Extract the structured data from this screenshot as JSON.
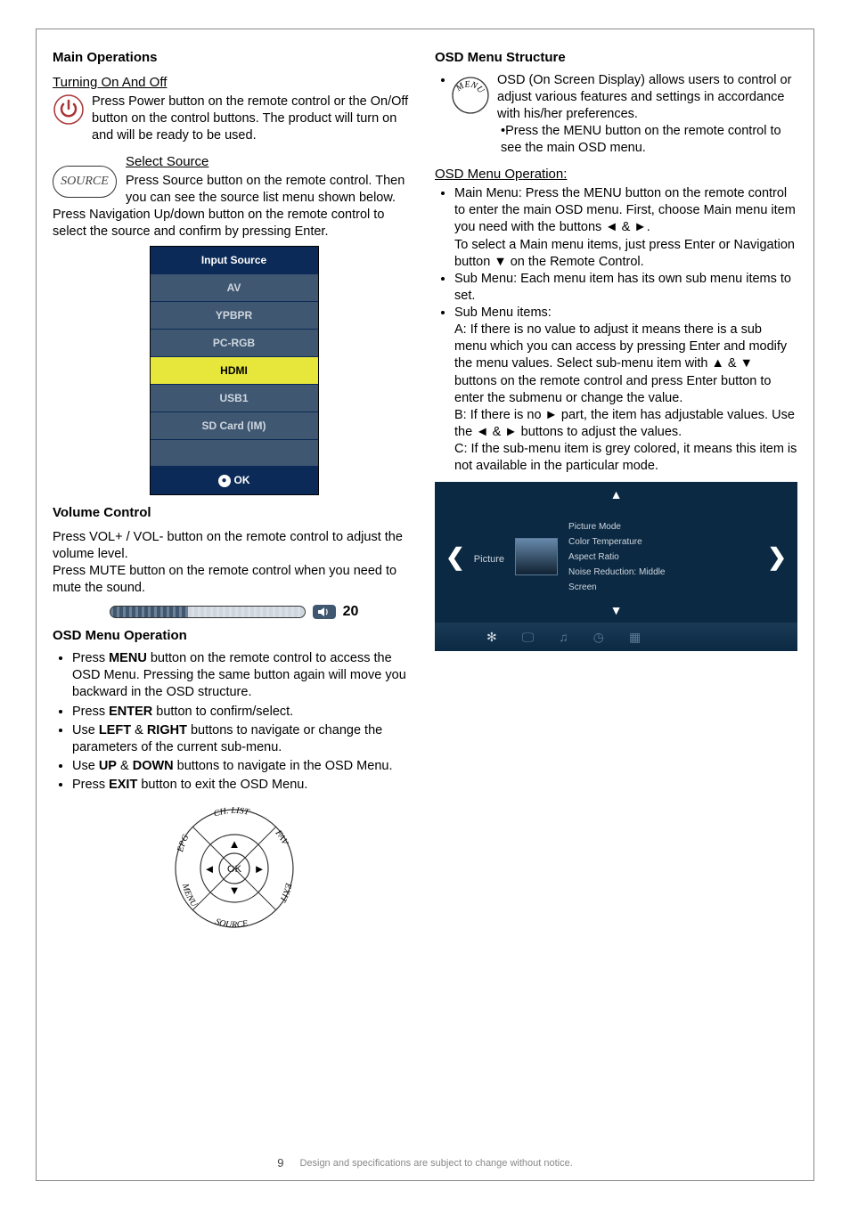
{
  "page_number": "9",
  "footer_note": "Design and specifications are subject to change without notice.",
  "left": {
    "main_ops": "Main Operations",
    "turning_h": "Turning On And Off",
    "turning_p": "Press Power button on the remote control or the On/Off button on the control buttons. The product will turn on and will be ready to be used.",
    "select_h": "Select Source",
    "source_label": "SOURCE",
    "select_p1": "Press Source button on the remote control. Then you can see the source list menu shown below.",
    "select_p2": "Press Navigation Up/down button on the remote control to select the source and confirm by pressing Enter.",
    "src_menu_head": "Input Source",
    "src_items": [
      "AV",
      "YPBPR",
      "PC-RGB",
      "HDMI",
      "USB1",
      "SD Card (IM)"
    ],
    "src_selected_index": 3,
    "src_ok": "OK",
    "vol_h": "Volume Control",
    "vol_p1": "Press VOL+ / VOL- button on the remote control to adjust the",
    "vol_p2": "volume level.",
    "vol_p3": "Press MUTE button on the remote control when you need to mute the sound.",
    "vol_value": "20",
    "osd_op_h": "OSD Menu Operation",
    "osd_li1a": "Press ",
    "osd_li1b": "MENU",
    "osd_li1c": " button on the remote control to access the OSD Menu. Pressing the same button again will move you backward in the OSD structure.",
    "osd_li2a": "Press ",
    "osd_li2b": "ENTER",
    "osd_li2c": " button to confirm/select.",
    "osd_li3a": "Use ",
    "osd_li3b": "LEFT",
    "osd_li3c": " & ",
    "osd_li3d": "RIGHT",
    "osd_li3e": " buttons to navigate or change the parameters of the current sub-menu.",
    "osd_li4a": "Use ",
    "osd_li4b": "UP",
    "osd_li4c": " & ",
    "osd_li4d": "DOWN",
    "osd_li4e": " buttons to navigate in the OSD Menu.",
    "osd_li5a": "Press ",
    "osd_li5b": "EXIT",
    "osd_li5c": " button to exit the OSD Menu.",
    "remote_labels": {
      "ch": "CH. LIST",
      "fav": "FAV",
      "exit": "EXIT",
      "source": "SOURCE",
      "menu": "MENU",
      "epg": "EPG",
      "ok": "OK"
    }
  },
  "right": {
    "osd_struct_h": "OSD Menu Structure",
    "menu_icon_label": "MENU",
    "osd_struct_p1": "OSD (On Screen Display) allows users to control or adjust various features and settings in accordance with his/her preferences.",
    "osd_struct_p2": "•Press the MENU button on the remote control to see the main OSD menu.",
    "osd_op_h": "OSD Menu Operation:",
    "li_main": "Main Menu: Press the MENU button on the remote control to enter the main OSD menu. First, choose Main menu item you need with the buttons ◄ & ►.",
    "li_main_b": "To select a Main menu items, just press Enter or Navigation button ▼ on the Remote Control.",
    "li_sub": "Sub Menu: Each menu item has its own sub menu items to set.",
    "li_items": "Sub Menu items:",
    "li_items_a": "A: If there is no value to adjust it means there is a sub menu which you can access by pressing Enter and modify the menu values. Select sub-menu item with ▲ & ▼ buttons on the remote control and press Enter button to enter the submenu or change the value.",
    "li_items_b": "B: If there is no ► part, the item has adjustable values. Use the ◄ & ► buttons to adjust the values.",
    "li_items_c": "C: If the sub-menu item is grey colored, it means this item is not available in the particular mode.",
    "osd_preview": {
      "cat": "Picture",
      "items": [
        "Picture Mode",
        "Color Temperature",
        "Aspect Ratio",
        "Noise Reduction: Middle",
        "Screen"
      ]
    }
  }
}
